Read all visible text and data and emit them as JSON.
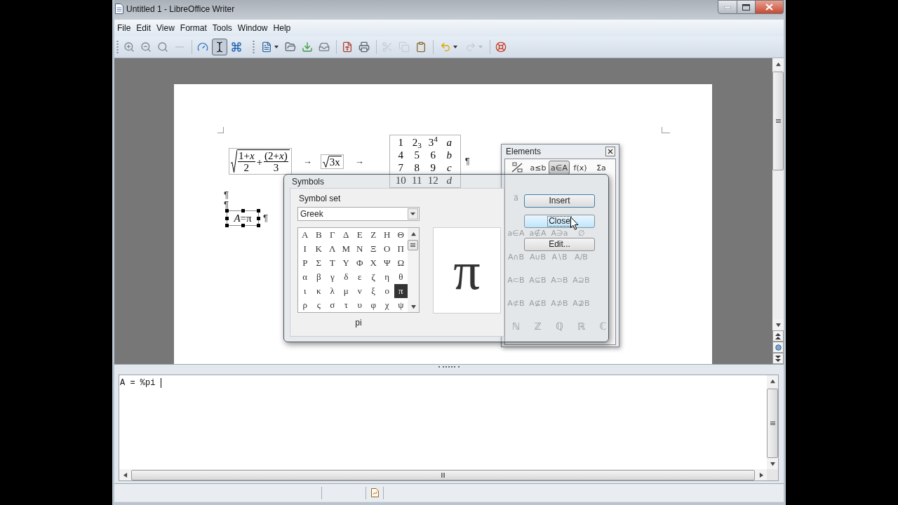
{
  "window": {
    "title": "Untitled 1 - LibreOffice Writer"
  },
  "menu": [
    "File",
    "Edit",
    "View",
    "Format",
    "Tools",
    "Window",
    "Help"
  ],
  "toolbars": [
    {
      "groups": [
        [
          {
            "disabled": false,
            "pressed": false,
            "dropdown": false
          },
          {
            "disabled": false,
            "pressed": false,
            "dropdown": false
          },
          {
            "disabled": false,
            "pressed": false,
            "dropdown": false
          },
          {
            "disabled": true,
            "pressed": false,
            "dropdown": false
          }
        ],
        [
          {
            "disabled": false,
            "pressed": false,
            "dropdown": false
          },
          {
            "disabled": false,
            "pressed": true,
            "dropdown": false
          },
          {
            "disabled": false,
            "pressed": false,
            "dropdown": false
          }
        ]
      ]
    },
    {
      "groups": [
        [
          {
            "disabled": false,
            "pressed": false,
            "dropdown": true
          },
          {
            "disabled": false,
            "pressed": false,
            "dropdown": false
          },
          {
            "disabled": false,
            "pressed": false,
            "dropdown": false
          },
          {
            "disabled": false,
            "pressed": false,
            "dropdown": false
          }
        ],
        [
          {
            "disabled": false,
            "pressed": false,
            "dropdown": false
          },
          {
            "disabled": false,
            "pressed": false,
            "dropdown": false
          }
        ],
        [
          {
            "disabled": true,
            "pressed": false,
            "dropdown": false
          },
          {
            "disabled": true,
            "pressed": false,
            "dropdown": false
          },
          {
            "disabled": false,
            "pressed": false,
            "dropdown": false
          }
        ],
        [
          {
            "disabled": false,
            "pressed": false,
            "dropdown": true
          },
          {
            "disabled": true,
            "pressed": false,
            "dropdown": true
          }
        ],
        [
          {
            "disabled": false,
            "pressed": false,
            "dropdown": false
          }
        ]
      ]
    }
  ],
  "page": {
    "paragraphs": [
      {
        "items": [
          {
            "kind": "root",
            "radicand": [
              {
                "kind": "fraction",
                "numerator": "1+*x*",
                "denominator": "2"
              },
              {
                "kind": "operator",
                "text": "+"
              },
              {
                "kind": "fraction",
                "numerator": "(2+*x*)",
                "denominator": "3"
              }
            ]
          },
          {
            "kind": "arrow",
            "text": "→"
          },
          {
            "kind": "root",
            "radicand": [
              {
                "kind": "text",
                "text": "3x"
              }
            ]
          },
          {
            "kind": "arrow",
            "text": "→"
          },
          {
            "kind": "matrix",
            "rows": [
              [
                {
                  "text": "1",
                  "italic": false
                },
                {
                  "text": "2$_{3}$",
                  "italic": false
                },
                {
                  "text": "3$^{4}$",
                  "italic": false
                },
                {
                  "text": "a",
                  "italic": true
                }
              ],
              [
                {
                  "text": "4",
                  "italic": false
                },
                {
                  "text": "5",
                  "italic": false
                },
                {
                  "text": "6",
                  "italic": false
                },
                {
                  "text": "b",
                  "italic": true
                }
              ],
              [
                {
                  "text": "7",
                  "italic": false
                },
                {
                  "text": "8",
                  "italic": false
                },
                {
                  "text": "9",
                  "italic": false
                },
                {
                  "text": "c",
                  "italic": true
                }
              ],
              [
                {
                  "text": "10",
                  "italic": false
                },
                {
                  "text": "11",
                  "italic": false
                },
                {
                  "text": "12",
                  "italic": false
                },
                {
                  "text": "d",
                  "italic": true
                }
              ]
            ]
          }
        ],
        "mark": "¶"
      },
      {
        "mark": "¶"
      },
      {
        "mark": "¶"
      },
      {
        "items": [
          {
            "kind": "frame",
            "text": "*A*=π",
            "selected": true
          }
        ],
        "mark": "¶"
      }
    ]
  },
  "symbols_dialog": {
    "title": "Symbols",
    "set_label": "Symbol set",
    "set_value": "Greek",
    "grid": [
      [
        {
          "symbol": "Α",
          "selected": false
        },
        {
          "symbol": "Β",
          "selected": false
        },
        {
          "symbol": "Γ",
          "selected": false
        },
        {
          "symbol": "Δ",
          "selected": false
        },
        {
          "symbol": "Ε",
          "selected": false
        },
        {
          "symbol": "Ζ",
          "selected": false
        },
        {
          "symbol": "Η",
          "selected": false
        },
        {
          "symbol": "Θ",
          "selected": false
        }
      ],
      [
        {
          "symbol": "Ι",
          "selected": false
        },
        {
          "symbol": "Κ",
          "selected": false
        },
        {
          "symbol": "Λ",
          "selected": false
        },
        {
          "symbol": "Μ",
          "selected": false
        },
        {
          "symbol": "Ν",
          "selected": false
        },
        {
          "symbol": "Ξ",
          "selected": false
        },
        {
          "symbol": "Ο",
          "selected": false
        },
        {
          "symbol": "Π",
          "selected": false
        }
      ],
      [
        {
          "symbol": "Ρ",
          "selected": false
        },
        {
          "symbol": "Σ",
          "selected": false
        },
        {
          "symbol": "Τ",
          "selected": false
        },
        {
          "symbol": "Υ",
          "selected": false
        },
        {
          "symbol": "Φ",
          "selected": false
        },
        {
          "symbol": "Χ",
          "selected": false
        },
        {
          "symbol": "Ψ",
          "selected": false
        },
        {
          "symbol": "Ω",
          "selected": false
        }
      ],
      [
        {
          "symbol": "α",
          "selected": false
        },
        {
          "symbol": "β",
          "selected": false
        },
        {
          "symbol": "γ",
          "selected": false
        },
        {
          "symbol": "δ",
          "selected": false
        },
        {
          "symbol": "ε",
          "selected": false
        },
        {
          "symbol": "ζ",
          "selected": false
        },
        {
          "symbol": "η",
          "selected": false
        },
        {
          "symbol": "θ",
          "selected": false
        }
      ],
      [
        {
          "symbol": "ι",
          "selected": false
        },
        {
          "symbol": "κ",
          "selected": false
        },
        {
          "symbol": "λ",
          "selected": false
        },
        {
          "symbol": "μ",
          "selected": false
        },
        {
          "symbol": "ν",
          "selected": false
        },
        {
          "symbol": "ξ",
          "selected": false
        },
        {
          "symbol": "ο",
          "selected": false
        },
        {
          "symbol": "π",
          "selected": true
        }
      ],
      [
        {
          "symbol": "ρ",
          "selected": false
        },
        {
          "symbol": "ς",
          "selected": false
        },
        {
          "symbol": "σ",
          "selected": false
        },
        {
          "symbol": "τ",
          "selected": false
        },
        {
          "symbol": "υ",
          "selected": false
        },
        {
          "symbol": "φ",
          "selected": false
        },
        {
          "symbol": "χ",
          "selected": false
        },
        {
          "symbol": "ψ",
          "selected": false
        }
      ]
    ],
    "preview": "π",
    "name": "pi",
    "buttons": [
      {
        "label": "Insert",
        "default": true,
        "hovered": false,
        "focused": false
      },
      {
        "label": "Close",
        "default": false,
        "hovered": true,
        "focused": true
      },
      {
        "label": "Edit...",
        "default": false,
        "hovered": false,
        "focused": false
      }
    ]
  },
  "elements_panel": {
    "title": "Elements",
    "categories": [
      {
        "kind": "icon",
        "selected": false
      },
      {
        "kind": "text",
        "label": "a≤b",
        "selected": false
      },
      {
        "kind": "text",
        "label": "a∈A",
        "selected": true
      },
      {
        "kind": "text",
        "label": "f(x)",
        "selected": false
      },
      {
        "kind": "text",
        "label": "Σa",
        "selected": false
      }
    ],
    "rows": [
      [
        "a⃗"
      ],
      [
        "a∈A",
        "a∉A",
        "A∋a",
        "∅"
      ],
      [
        "A∩B",
        "A∪B",
        "A∖B",
        "A/B"
      ],
      [
        "A⊂B",
        "A⊆B",
        "A⊃B",
        "A⊇B"
      ],
      [
        "A⊄B",
        "A⊈B",
        "A⊅B",
        "A⊉B"
      ],
      [
        "ℕ",
        "ℤ",
        "ℚ",
        "ℝ",
        "ℂ"
      ]
    ]
  },
  "formula_editor": {
    "text": "A = %pi"
  },
  "status_bar": {
    "document_modified": true
  }
}
